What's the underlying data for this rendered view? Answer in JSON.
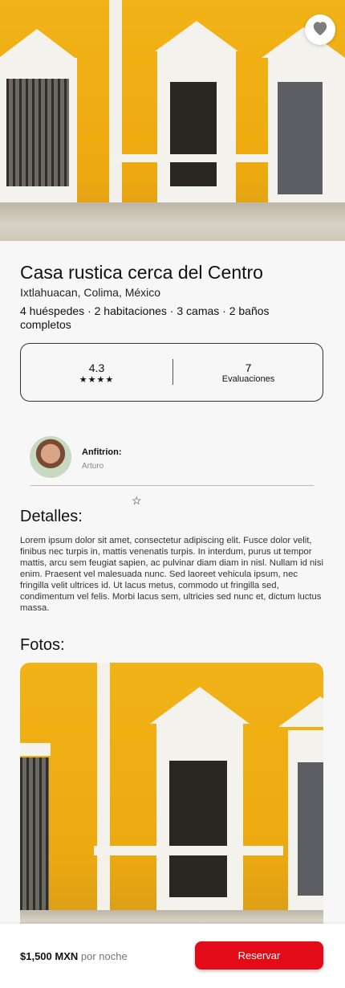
{
  "listing": {
    "title": "Casa rustica cerca del Centro",
    "location": "Ixtlahuacan, Colima, México",
    "features": "4 huéspedes · 2 habitaciones · 3 camas · 2 baños completos"
  },
  "stats": {
    "rating": "4.3",
    "stars": "★★★★",
    "reviews_count": "7",
    "reviews_label": "Evaluaciones"
  },
  "host": {
    "label": "Anfitrion:",
    "name": "Arturo"
  },
  "rating_star": "☆",
  "details": {
    "heading": "Detalles:",
    "text": "Lorem ipsum dolor sit amet, consectetur adipiscing elit. Fusce dolor velit, finibus nec turpis in, mattis venenatis turpis. In interdum, purus ut tempor mattis, arcu sem feugiat sapien, ac pulvinar diam diam in nisl. Nullam id nisi enim. Praesent vel malesuada nunc. Sed laoreet vehicula ipsum, nec fringilla velit ultrices id. Ut lacus metus, commodo ut fringilla sed, condimentum vel felis. Morbi lacus sem, ultricies sed nunc et, dictum luctus massa."
  },
  "photos": {
    "heading": "Fotos:"
  },
  "booking": {
    "price": "$1,500 MXN",
    "per_night": "por noche",
    "reserve_label": "Reservar"
  },
  "icons": {
    "favorite": "heart-icon"
  },
  "colors": {
    "accent": "#e30b17",
    "facade": "#f1b317"
  }
}
